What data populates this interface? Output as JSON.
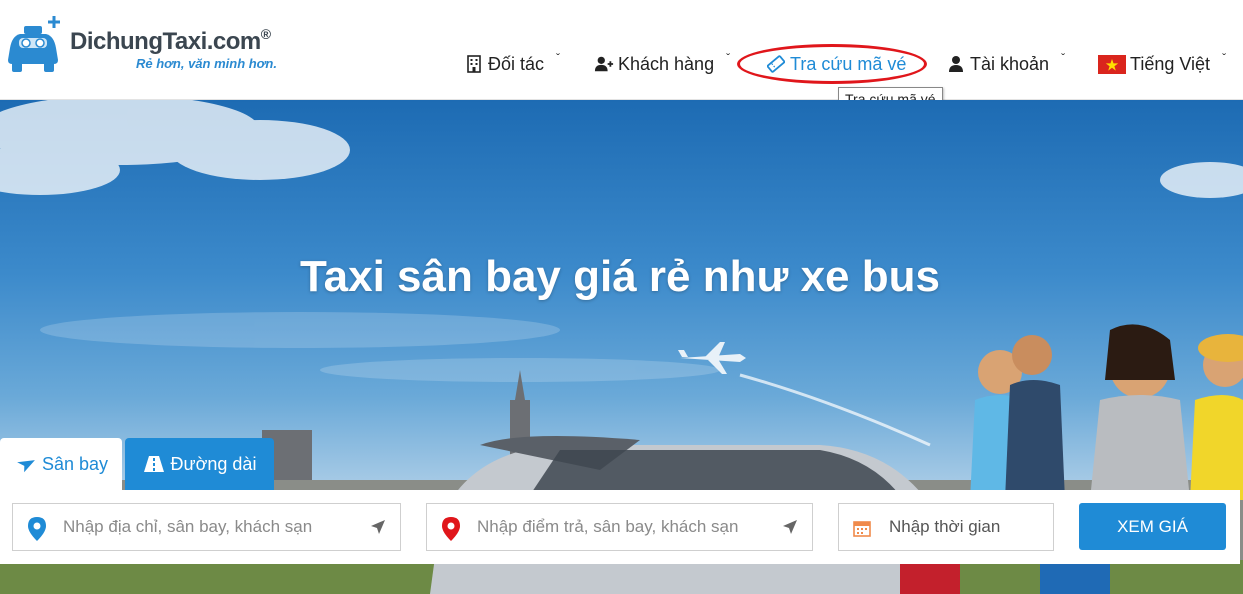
{
  "brand": {
    "name": "DichungTaxi.com",
    "registered": "®",
    "slogan": "Rẻ hơn, văn minh hơn."
  },
  "nav": {
    "partners": "Đối tác",
    "customers": "Khách hàng",
    "ticket_lookup": "Tra cứu mã vé",
    "account": "Tài khoản",
    "language": "Tiếng Việt",
    "tooltip": "Tra cứu mã vé"
  },
  "hero": {
    "title": "Taxi sân bay giá rẻ như xe bus"
  },
  "booking": {
    "tabs": [
      {
        "label": "Sân bay",
        "active": false
      },
      {
        "label": "Đường dài",
        "active": true
      }
    ],
    "from_placeholder": "Nhập địa chỉ, sân bay, khách sạn",
    "to_placeholder": "Nhập điểm trả, sân bay, khách sạn",
    "time_placeholder": "Nhập thời gian",
    "submit_label": "XEM GIÁ"
  },
  "colors": {
    "primary": "#1f8bd6",
    "highlight": "#e0161b",
    "pin_from": "#1f8bd6",
    "pin_to": "#e0161b",
    "calendar": "#f08a4b"
  },
  "icons": {
    "partners": "building-icon",
    "customers": "user-plus-icon",
    "ticket_lookup": "ticket-icon",
    "account": "user-icon",
    "language": "vietnam-flag-icon",
    "tab_airport": "plane-icon",
    "tab_long": "road-icon"
  }
}
